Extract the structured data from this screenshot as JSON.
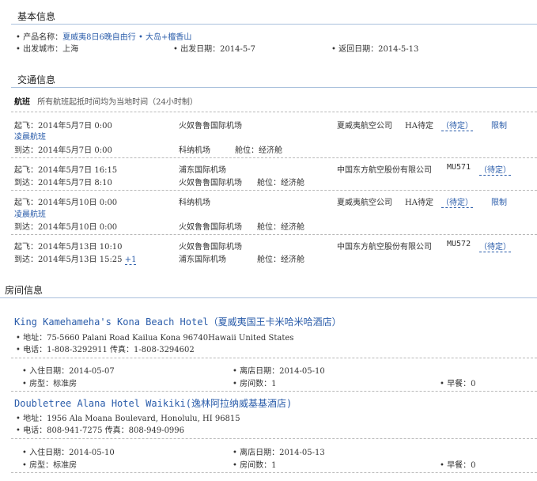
{
  "basic": {
    "title": "基本信息",
    "product_label": "• 产品名称：",
    "product_value": "夏威夷8日6晚自由行 • 大岛+檀香山",
    "city_label": "• 出发城市：上海",
    "depart_label": "• 出发日期：2014-5-7",
    "return_label": "• 返回日期：2014-5-13"
  },
  "transport": {
    "title": "交通信息",
    "flight_tag": "航班",
    "note": "所有航班起抵时间均为当地时间（24小时制）",
    "segments": [
      {
        "dep": "起飞：2014年5月7日 0:00",
        "dep_airport": "火奴鲁鲁国际机场",
        "airline": "夏威夷航空公司",
        "flight_no": "HA待定",
        "status": "（待定）",
        "limit": "限制",
        "redeye": "凌晨航班",
        "arr": "到达：2014年5月7日 0:00",
        "arr_airport": "科纳机场",
        "cabin": "舱位：经济舱"
      },
      {
        "dep": "起飞：2014年5月7日 16:15",
        "dep_airport": "浦东国际机场",
        "airline": "中国东方航空股份有限公司",
        "flight_no": "MU571",
        "status": "（待定）",
        "arr": "到达：2014年5月7日 8:10",
        "arr_airport": "火奴鲁鲁国际机场",
        "cabin": "舱位：经济舱"
      },
      {
        "dep": "起飞：2014年5月10日 0:00",
        "dep_airport": "科纳机场",
        "airline": "夏威夷航空公司",
        "flight_no": "HA待定",
        "status": "（待定）",
        "limit": "限制",
        "redeye": "凌晨航班",
        "arr": "到达：2014年5月10日 0:00",
        "arr_airport": "火奴鲁鲁国际机场",
        "cabin": "舱位：经济舱"
      },
      {
        "dep": "起飞：2014年5月13日 10:10",
        "dep_airport": "火奴鲁鲁国际机场",
        "airline": "中国东方航空股份有限公司",
        "flight_no": "MU572",
        "status": "（待定）",
        "arr": "到达：2014年5月13日 15:25",
        "next_day": "+1",
        "arr_airport": "浦东国际机场",
        "cabin": "舱位：经济舱"
      }
    ]
  },
  "rooms": {
    "title": "房间信息",
    "hotels": [
      {
        "name": "King Kamehameha's Kona Beach Hotel（夏威夷国王卡米哈米哈酒店）",
        "address": "• 地址：75-5660 Palani Road Kailua Kona 96740Hawaii United States",
        "phone": "• 电话：1-808-3292911    传真：1-808-3294602",
        "checkin": "• 入住日期：2014-05-07",
        "checkout": "• 离店日期：2014-05-10",
        "room_type": "• 房型：标准房",
        "room_count": "• 房间数：1",
        "breakfast": "• 早餐：0"
      },
      {
        "name": "Doubletree Alana Hotel Waikiki(逸林阿拉纳威基基酒店)",
        "address": "• 地址：1956 Ala Moana Boulevard, Honolulu, HI 96815",
        "phone": "• 电话：808-941-7275    传真：808-949-0996",
        "checkin": "• 入住日期：2014-05-10",
        "checkout": "• 离店日期：2014-05-13",
        "room_type": "• 房型：标准房",
        "room_count": "• 房间数：1",
        "breakfast": "• 早餐：0"
      }
    ]
  }
}
